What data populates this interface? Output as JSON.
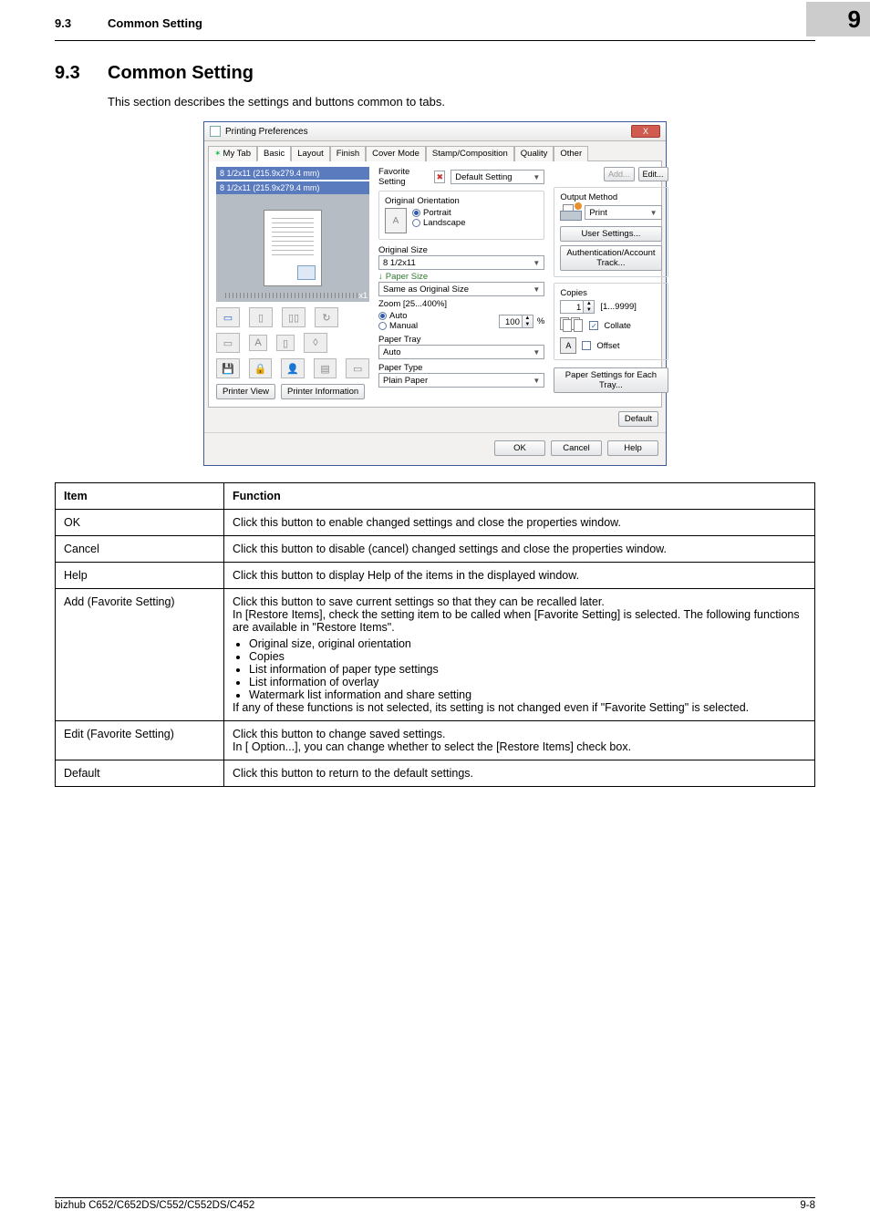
{
  "header": {
    "section_no": "9.3",
    "section_name": "Common Setting",
    "chapter_no": "9"
  },
  "section": {
    "number": "9.3",
    "title": "Common Setting",
    "intro": "This section describes the settings and buttons common to tabs."
  },
  "dialog": {
    "title": "Printing Preferences",
    "close_x": "X",
    "tabs": {
      "my_tab": "My Tab",
      "basic": "Basic",
      "layout": "Layout",
      "finish": "Finish",
      "cover": "Cover Mode",
      "stamp": "Stamp/Composition",
      "quality": "Quality",
      "other": "Other"
    },
    "size_top": "8 1/2x11 (215.9x279.4 mm)",
    "size_bottom": "8 1/2x11 (215.9x279.4 mm)",
    "x1": "x1",
    "printer_view": "Printer View",
    "printer_info": "Printer Information",
    "fav_label": "Favorite Setting",
    "fav_value": "Default Setting",
    "add_btn": "Add...",
    "edit_btn": "Edit...",
    "orig_orient": "Original Orientation",
    "portrait": "Portrait",
    "landscape": "Landscape",
    "orig_size": "Original Size",
    "orig_size_val": "8 1/2x11",
    "paper_size": "Paper Size",
    "same_as": "Same as Original Size",
    "zoom_label": "Zoom [25...400%]",
    "auto": "Auto",
    "manual": "Manual",
    "zoom_val": "100",
    "pct": "%",
    "paper_tray": "Paper Tray",
    "paper_tray_val": "Auto",
    "paper_type": "Paper Type",
    "paper_type_val": "Plain Paper",
    "output_method": "Output Method",
    "print": "Print",
    "user_settings": "User Settings...",
    "auth_track": "Authentication/Account Track...",
    "copies": "Copies",
    "copies_val": "1",
    "copies_range": "[1...9999]",
    "collate": "Collate",
    "offset": "Offset",
    "paper_settings_tray": "Paper Settings for Each Tray...",
    "default_btn": "Default",
    "ok": "OK",
    "cancel": "Cancel",
    "help": "Help"
  },
  "table": {
    "head_item": "Item",
    "head_function": "Function",
    "rows": {
      "ok": {
        "item": "OK",
        "func": "Click this button to enable changed settings and close the properties window."
      },
      "cancel": {
        "item": "Cancel",
        "func": "Click this button to disable (cancel) changed settings and close the properties window."
      },
      "help": {
        "item": "Help",
        "func": "Click this button to display Help of the items in the displayed window."
      },
      "add": {
        "item": "Add (Favorite Setting)",
        "intro1": "Click this button to save current settings so that they can be recalled later.",
        "intro2": "In [Restore Items], check the setting item to be called when [Favorite Setting] is selected. The following functions are available in \"Restore Items\".",
        "b1": "Original size, original orientation",
        "b2": "Copies",
        "b3": "List information of paper type settings",
        "b4": "List information of overlay",
        "b5": "Watermark list information and share setting",
        "outro": "If any of these functions is not selected, its setting is not changed even if \"Favorite Setting\" is selected."
      },
      "edit": {
        "item": "Edit (Favorite Setting)",
        "l1": "Click this button to change saved settings.",
        "l2": "In [ Option...], you can change whether to select the [Restore Items] check box."
      },
      "default": {
        "item": "Default",
        "func": "Click this button to return to the default settings."
      }
    }
  },
  "footer": {
    "model": "bizhub C652/C652DS/C552/C552DS/C452",
    "page": "9-8"
  }
}
